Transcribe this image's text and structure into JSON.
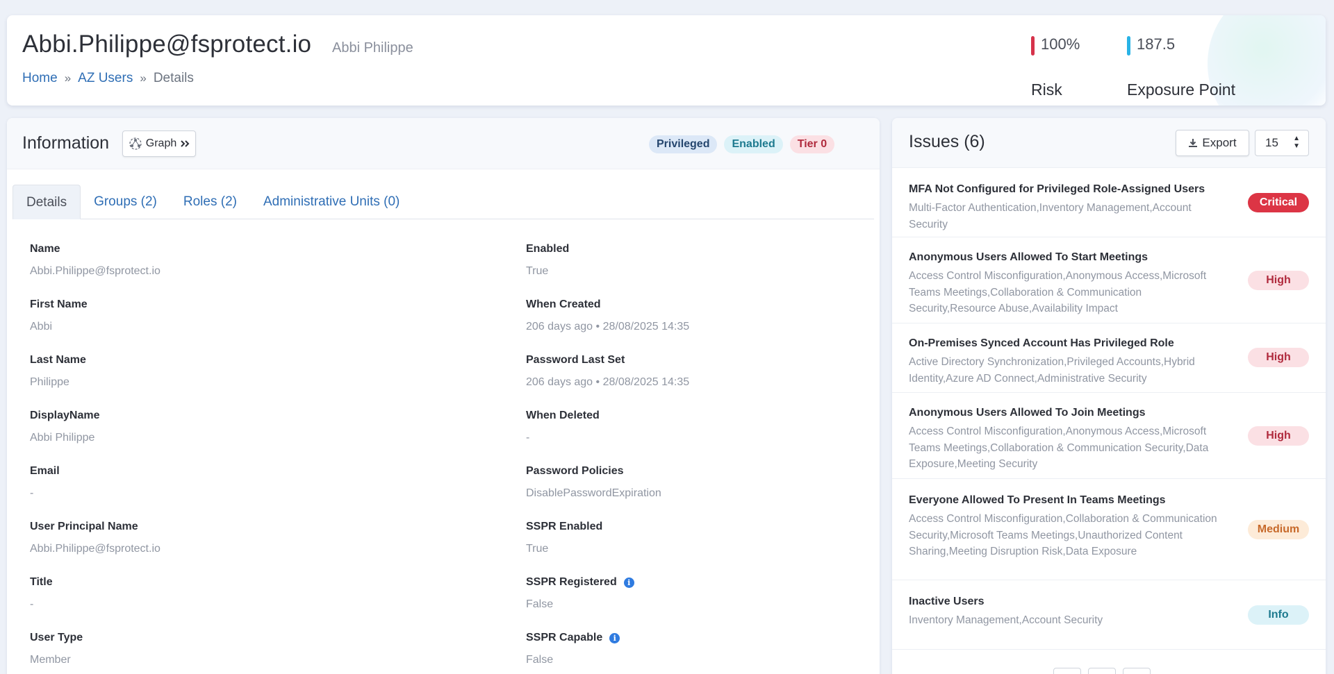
{
  "header": {
    "title": "Abbi.Philippe@fsprotect.io",
    "subtitle": "Abbi Philippe",
    "breadcrumb": {
      "home": "Home",
      "section": "AZ Users",
      "current": "Details",
      "separator": "»"
    },
    "metrics": {
      "risk": {
        "value": "100%",
        "label": "Risk",
        "color": "#d6334b"
      },
      "exposure": {
        "value": "187.5",
        "label": "Exposure Point",
        "color": "#29b3e6"
      }
    }
  },
  "info": {
    "title": "Information",
    "graph_button": "Graph",
    "badges": {
      "privileged": "Privileged",
      "enabled": "Enabled",
      "tier": "Tier 0"
    },
    "tabs": [
      "Details",
      "Groups (2)",
      "Roles (2)",
      "Administrative Units (0)"
    ],
    "left_fields": [
      {
        "label": "Name",
        "value": "Abbi.Philippe@fsprotect.io"
      },
      {
        "label": "First Name",
        "value": "Abbi"
      },
      {
        "label": "Last Name",
        "value": "Philippe"
      },
      {
        "label": "DisplayName",
        "value": "Abbi Philippe"
      },
      {
        "label": "Email",
        "value": "-"
      },
      {
        "label": "User Principal Name",
        "value": "Abbi.Philippe@fsprotect.io"
      },
      {
        "label": "Title",
        "value": "-"
      },
      {
        "label": "User Type",
        "value": "Member"
      }
    ],
    "right_fields": [
      {
        "label": "Enabled",
        "value": "True"
      },
      {
        "label": "When Created",
        "value": "206 days ago • 28/08/2025 14:35"
      },
      {
        "label": "Password Last Set",
        "value": "206 days ago • 28/08/2025 14:35"
      },
      {
        "label": "When Deleted",
        "value": "-"
      },
      {
        "label": "Password Policies",
        "value": "DisablePasswordExpiration"
      },
      {
        "label": "SSPR Enabled",
        "value": "True"
      },
      {
        "label": "SSPR Registered",
        "value": "False"
      },
      {
        "label": "SSPR Capable",
        "value": "False"
      }
    ]
  },
  "issues": {
    "title": "Issues (6)",
    "export_label": "Export",
    "page_size": "15",
    "items": [
      {
        "title": "MFA Not Configured for Privileged Role-Assigned Users",
        "categories": "Multi-Factor Authentication,Inventory Management,Account Security",
        "severity": "Critical"
      },
      {
        "title": "Anonymous Users Allowed To Start Meetings",
        "categories": "Access Control Misconfiguration,Anonymous Access,Microsoft Teams Meetings,Collaboration & Communication Security,Resource Abuse,Availability Impact",
        "severity": "High"
      },
      {
        "title": "On-Premises Synced Account Has Privileged Role",
        "categories": "Active Directory Synchronization,Privileged Accounts,Hybrid Identity,Azure AD Connect,Administrative Security",
        "severity": "High"
      },
      {
        "title": "Anonymous Users Allowed To Join Meetings",
        "categories": "Access Control Misconfiguration,Anonymous Access,Microsoft Teams Meetings,Collaboration & Communication Security,Data Exposure,Meeting Security",
        "severity": "High"
      },
      {
        "title": "Everyone Allowed To Present In Teams Meetings",
        "categories": "Access Control Misconfiguration,Collaboration & Communication Security,Microsoft Teams Meetings,Unauthorized Content Sharing,Meeting Disruption Risk,Data Exposure",
        "severity": "Medium"
      },
      {
        "title": "Inactive Users",
        "categories": "Inventory Management,Account Security",
        "severity": "Info"
      }
    ]
  }
}
